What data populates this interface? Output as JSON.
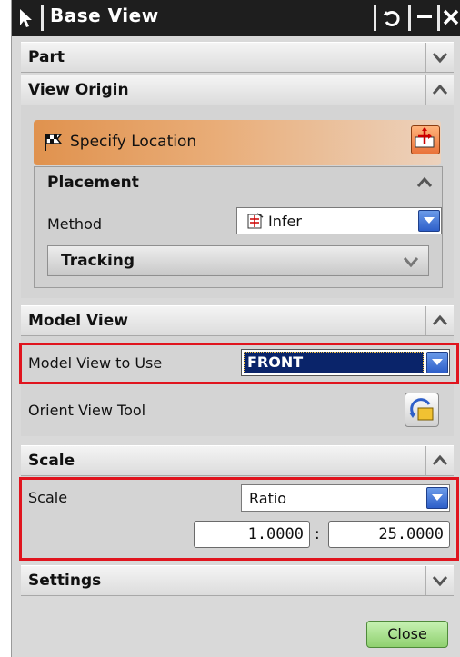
{
  "window": {
    "title": "Base View"
  },
  "sections": {
    "part": {
      "label": "Part",
      "state": "collapsed"
    },
    "view_origin": {
      "label": "View Origin",
      "state": "expanded"
    },
    "model_view": {
      "label": "Model View",
      "state": "expanded"
    },
    "scale": {
      "label": "Scale",
      "state": "expanded"
    },
    "settings": {
      "label": "Settings",
      "state": "collapsed"
    }
  },
  "view_origin": {
    "specify_location": "Specify Location",
    "placement": {
      "label": "Placement",
      "method_label": "Method",
      "method_value": "Infer",
      "tracking_label": "Tracking"
    }
  },
  "model_view": {
    "model_view_label": "Model View to Use",
    "model_view_value": "FRONT",
    "orient_label": "Orient View Tool"
  },
  "scale": {
    "label": "Scale",
    "type_value": "Ratio",
    "numerator": "1.0000",
    "separator": ":",
    "denominator": "25.0000"
  },
  "footer": {
    "close_label": "Close"
  },
  "colors": {
    "highlight_border": "#e0141e",
    "selected_bg": "#0a246a",
    "titlebar_bg": "#1e1e1e",
    "close_button": "#9fd87f"
  },
  "icons": [
    "arrow-cursor-icon",
    "reset-icon",
    "minimize-icon",
    "close-icon",
    "chevron-down-icon",
    "chevron-up-icon",
    "flag-icon",
    "point-location-icon",
    "infer-icon",
    "orient-view-icon"
  ]
}
